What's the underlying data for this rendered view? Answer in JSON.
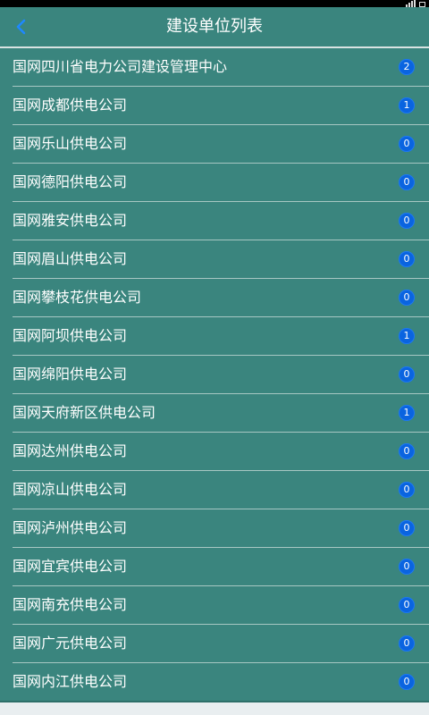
{
  "status_bar": {
    "icons": [
      "signal-icon",
      "battery-icon"
    ]
  },
  "header": {
    "title": "建设单位列表",
    "back_icon": "chevron-left-icon"
  },
  "colors": {
    "header_bg": "#3a857e",
    "list_bg": "#3a857e",
    "badge_bg": "#0a64e0",
    "text": "#ffffff",
    "divider": "#a7c7c3"
  },
  "units": [
    {
      "name": "国网四川省电力公司建设管理中心",
      "count": "2"
    },
    {
      "name": "国网成都供电公司",
      "count": "1"
    },
    {
      "name": "国网乐山供电公司",
      "count": "0"
    },
    {
      "name": "国网德阳供电公司",
      "count": "0"
    },
    {
      "name": "国网雅安供电公司",
      "count": "0"
    },
    {
      "name": "国网眉山供电公司",
      "count": "0"
    },
    {
      "name": "国网攀枝花供电公司",
      "count": "0"
    },
    {
      "name": "国网阿坝供电公司",
      "count": "1"
    },
    {
      "name": "国网绵阳供电公司",
      "count": "0"
    },
    {
      "name": "国网天府新区供电公司",
      "count": "1"
    },
    {
      "name": "国网达州供电公司",
      "count": "0"
    },
    {
      "name": "国网凉山供电公司",
      "count": "0"
    },
    {
      "name": "国网泸州供电公司",
      "count": "0"
    },
    {
      "name": "国网宜宾供电公司",
      "count": "0"
    },
    {
      "name": "国网南充供电公司",
      "count": "0"
    },
    {
      "name": "国网广元供电公司",
      "count": "0"
    },
    {
      "name": "国网内江供电公司",
      "count": "0"
    }
  ]
}
